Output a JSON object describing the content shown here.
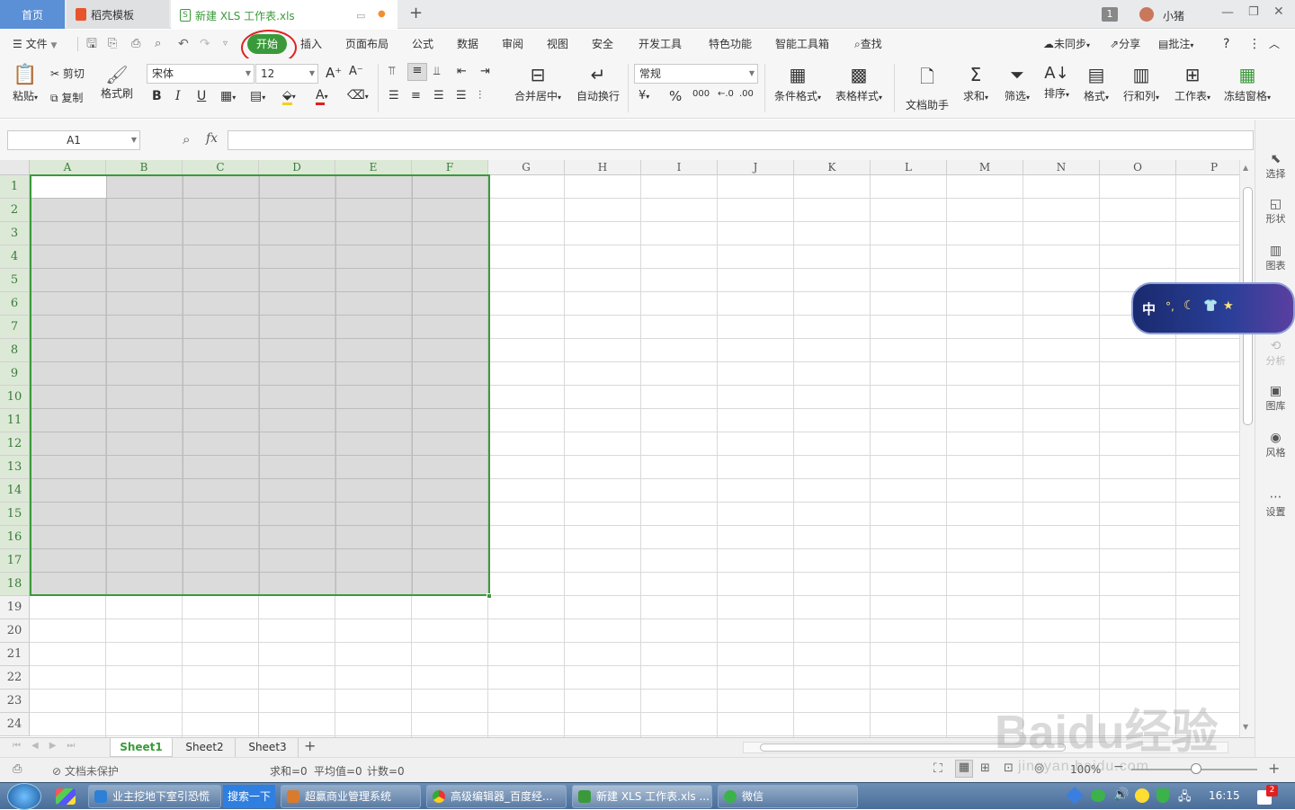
{
  "titlebar": {
    "home_tab": "首页",
    "template_tab": "稻壳模板",
    "doc_tab": "新建 XLS 工作表.xls",
    "new_tab": "+",
    "badge": "1",
    "user": "小猪"
  },
  "menu": {
    "file": "文件",
    "tabs": [
      "开始",
      "插入",
      "页面布局",
      "公式",
      "数据",
      "审阅",
      "视图",
      "安全",
      "开发工具",
      "特色功能",
      "智能工具箱"
    ],
    "search": "查找",
    "sync": "未同步",
    "share": "分享",
    "comment": "批注",
    "help": "?"
  },
  "ribbon": {
    "paste": "粘贴",
    "cut": "剪切",
    "copy": "复制",
    "format_painter": "格式刷",
    "font": "宋体",
    "font_size": "12",
    "bold": "B",
    "italic": "I",
    "underline": "U",
    "merge": "合并居中",
    "wrap": "自动换行",
    "number_format": "常规",
    "percent": "%",
    "cond_format": "条件格式",
    "table_style": "表格样式",
    "doc_helper": "文档助手",
    "sum": "求和",
    "filter": "筛选",
    "sort": "排序",
    "format": "格式",
    "row_col": "行和列",
    "worksheet": "工作表",
    "freeze": "冻结窗格"
  },
  "formula": {
    "cell_ref": "A1",
    "fx": "fx",
    "value": ""
  },
  "grid": {
    "columns": [
      "A",
      "B",
      "C",
      "D",
      "E",
      "F",
      "G",
      "H",
      "I",
      "J",
      "K",
      "L",
      "M",
      "N",
      "O",
      "P"
    ],
    "rows": [
      "1",
      "2",
      "3",
      "4",
      "5",
      "6",
      "7",
      "8",
      "9",
      "10",
      "11",
      "12",
      "13",
      "14",
      "15",
      "16",
      "17",
      "18",
      "19",
      "20",
      "21",
      "22",
      "23",
      "24"
    ]
  },
  "right_panel": {
    "select": "选择",
    "shape": "形状",
    "chart": "图表",
    "analysis": "分析",
    "gallery": "图库",
    "style": "风格",
    "settings": "设置"
  },
  "ime": {
    "label": "中",
    "symbols": "°,"
  },
  "sheets": {
    "tabs": [
      "Sheet1",
      "Sheet2",
      "Sheet3"
    ],
    "add": "+"
  },
  "status": {
    "protect": "文档未保护",
    "sum": "求和=0",
    "avg": "平均值=0",
    "count": "计数=0",
    "zoom": "100%"
  },
  "taskbar": {
    "items": [
      "业主挖地下室引恐慌",
      "搜索一下",
      "超赢商业管理系统",
      "高级编辑器_百度经...",
      "新建 XLS 工作表.xls ...",
      "微信"
    ],
    "time": "16:15",
    "notify_count": "2"
  },
  "watermark": {
    "brand": "Baidu经验",
    "url": "jingyan.baidu.com"
  }
}
